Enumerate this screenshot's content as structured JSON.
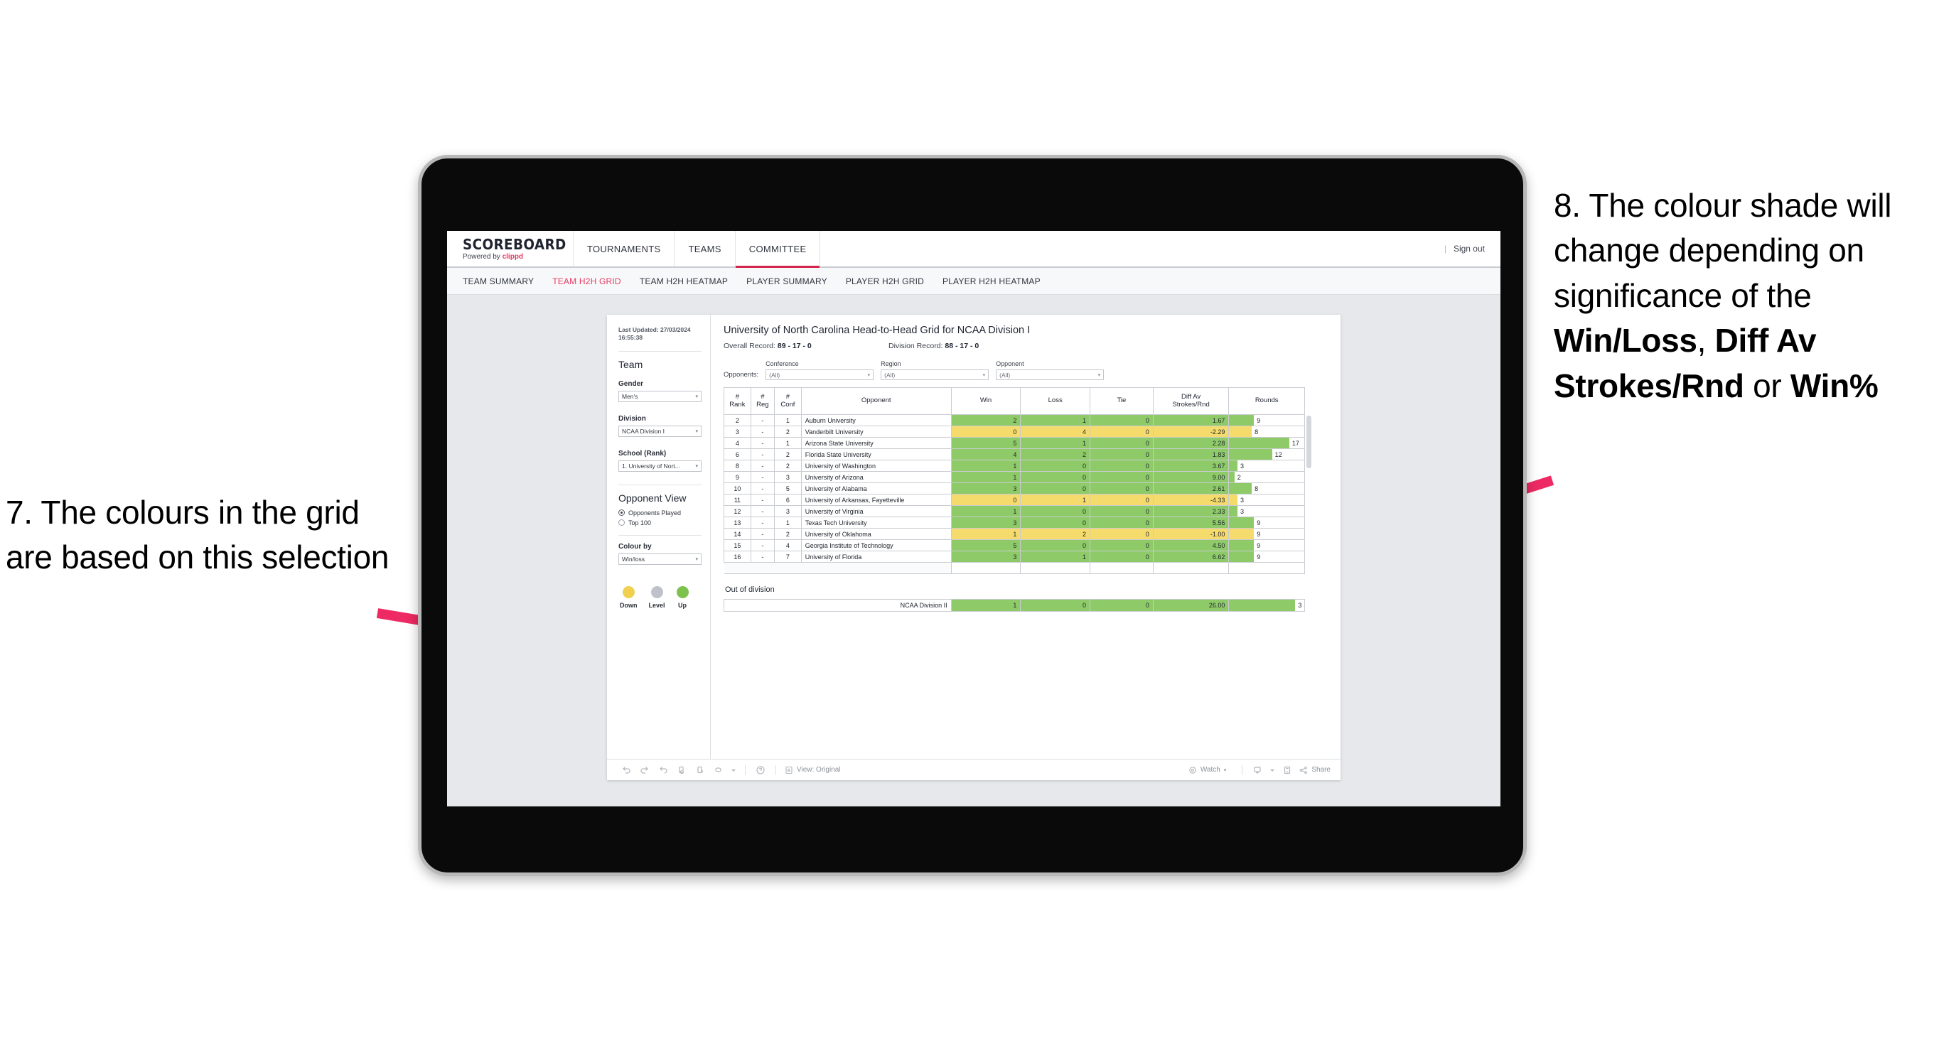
{
  "annotations": {
    "left": {
      "number": "7.",
      "text": "The colours in the grid are based on this selection"
    },
    "right": {
      "number": "8.",
      "line1": "The colour shade will change depending on significance of the ",
      "bold1": "Win/Loss",
      "mid1": ", ",
      "bold2": "Diff Av Strokes/Rnd",
      "mid2": " or ",
      "bold3": "Win%"
    }
  },
  "app": {
    "brand": {
      "title": "SCOREBOARD",
      "powered_prefix": "Powered by ",
      "powered_name": "clippd"
    },
    "topnav": [
      {
        "label": "TOURNAMENTS",
        "active": false
      },
      {
        "label": "TEAMS",
        "active": false
      },
      {
        "label": "COMMITTEE",
        "active": true
      }
    ],
    "signout": {
      "separator": "|",
      "label": "Sign out"
    },
    "subnav": [
      {
        "label": "TEAM SUMMARY",
        "active": false
      },
      {
        "label": "TEAM H2H GRID",
        "active": true
      },
      {
        "label": "TEAM H2H HEATMAP",
        "active": false
      },
      {
        "label": "PLAYER SUMMARY",
        "active": false
      },
      {
        "label": "PLAYER H2H GRID",
        "active": false
      },
      {
        "label": "PLAYER H2H HEATMAP",
        "active": false
      }
    ]
  },
  "filters": {
    "last_updated_label": "Last Updated: 27/03/2024",
    "last_updated_time": "16:55:38",
    "team_heading": "Team",
    "gender": {
      "label": "Gender",
      "value": "Men's"
    },
    "division": {
      "label": "Division",
      "value": "NCAA Division I"
    },
    "school": {
      "label": "School (Rank)",
      "value": "1. University of Nort..."
    },
    "opponent_view": {
      "heading": "Opponent View",
      "options": [
        {
          "label": "Opponents Played",
          "selected": true
        },
        {
          "label": "Top 100",
          "selected": false
        }
      ]
    },
    "colour_by": {
      "label": "Colour by",
      "value": "Win/loss"
    },
    "legend": [
      {
        "label": "Down",
        "color": "#f2d04f"
      },
      {
        "label": "Level",
        "color": "#bfc3c9"
      },
      {
        "label": "Up",
        "color": "#7dc24f"
      }
    ]
  },
  "view": {
    "title": "University of North Carolina Head-to-Head Grid for NCAA Division I",
    "overall_record_label": "Overall Record:",
    "overall_record_value": "89 - 17 - 0",
    "division_record_label": "Division Record:",
    "division_record_value": "88 - 17 - 0",
    "opponents_label": "Opponents:",
    "opponent_filters": [
      {
        "label": "Conference",
        "value": "(All)"
      },
      {
        "label": "Region",
        "value": "(All)"
      },
      {
        "label": "Opponent",
        "value": "(All)"
      }
    ],
    "columns": [
      "# Rank",
      "# Reg",
      "# Conf",
      "Opponent",
      "Win",
      "Loss",
      "Tie",
      "Diff Av Strokes/Rnd",
      "Rounds"
    ],
    "column_lines": [
      [
        "#",
        "Rank"
      ],
      [
        "#",
        "Reg"
      ],
      [
        "#",
        "Conf"
      ],
      [
        "Opponent",
        ""
      ],
      [
        "Win",
        ""
      ],
      [
        "Loss",
        ""
      ],
      [
        "Tie",
        ""
      ],
      [
        "Diff Av",
        "Strokes/Rnd"
      ],
      [
        "Rounds",
        ""
      ]
    ],
    "rows": [
      {
        "rank": "2",
        "reg": "-",
        "conf": "1",
        "opponent": "Auburn University",
        "win": "2",
        "loss": "1",
        "tie": "0",
        "diff": "1.67",
        "rounds": "9",
        "state": "up",
        "bar_pct": 33
      },
      {
        "rank": "3",
        "reg": "-",
        "conf": "2",
        "opponent": "Vanderbilt University",
        "win": "0",
        "loss": "4",
        "tie": "0",
        "diff": "-2.29",
        "rounds": "8",
        "state": "down",
        "bar_pct": 30
      },
      {
        "rank": "4",
        "reg": "-",
        "conf": "1",
        "opponent": "Arizona State University",
        "win": "5",
        "loss": "1",
        "tie": "0",
        "diff": "2.28",
        "rounds": "17",
        "state": "up",
        "bar_pct": 80
      },
      {
        "rank": "6",
        "reg": "-",
        "conf": "2",
        "opponent": "Florida State University",
        "win": "4",
        "loss": "2",
        "tie": "0",
        "diff": "1.83",
        "rounds": "12",
        "state": "up",
        "bar_pct": 57
      },
      {
        "rank": "8",
        "reg": "-",
        "conf": "2",
        "opponent": "University of Washington",
        "win": "1",
        "loss": "0",
        "tie": "0",
        "diff": "3.67",
        "rounds": "3",
        "state": "up",
        "bar_pct": 11
      },
      {
        "rank": "9",
        "reg": "-",
        "conf": "3",
        "opponent": "University of Arizona",
        "win": "1",
        "loss": "0",
        "tie": "0",
        "diff": "9.00",
        "rounds": "2",
        "state": "up",
        "bar_pct": 7
      },
      {
        "rank": "10",
        "reg": "-",
        "conf": "5",
        "opponent": "University of Alabama",
        "win": "3",
        "loss": "0",
        "tie": "0",
        "diff": "2.61",
        "rounds": "8",
        "state": "up",
        "bar_pct": 30
      },
      {
        "rank": "11",
        "reg": "-",
        "conf": "6",
        "opponent": "University of Arkansas, Fayetteville",
        "win": "0",
        "loss": "1",
        "tie": "0",
        "diff": "-4.33",
        "rounds": "3",
        "state": "down",
        "bar_pct": 11
      },
      {
        "rank": "12",
        "reg": "-",
        "conf": "3",
        "opponent": "University of Virginia",
        "win": "1",
        "loss": "0",
        "tie": "0",
        "diff": "2.33",
        "rounds": "3",
        "state": "up",
        "bar_pct": 11
      },
      {
        "rank": "13",
        "reg": "-",
        "conf": "1",
        "opponent": "Texas Tech University",
        "win": "3",
        "loss": "0",
        "tie": "0",
        "diff": "5.56",
        "rounds": "9",
        "state": "up",
        "bar_pct": 33
      },
      {
        "rank": "14",
        "reg": "-",
        "conf": "2",
        "opponent": "University of Oklahoma",
        "win": "1",
        "loss": "2",
        "tie": "0",
        "diff": "-1.00",
        "rounds": "9",
        "state": "down",
        "bar_pct": 33
      },
      {
        "rank": "15",
        "reg": "-",
        "conf": "4",
        "opponent": "Georgia Institute of Technology",
        "win": "5",
        "loss": "0",
        "tie": "0",
        "diff": "4.50",
        "rounds": "9",
        "state": "up",
        "bar_pct": 33
      },
      {
        "rank": "16",
        "reg": "-",
        "conf": "7",
        "opponent": "University of Florida",
        "win": "3",
        "loss": "1",
        "tie": "0",
        "diff": "6.62",
        "rounds": "9",
        "state": "up",
        "bar_pct": 33
      }
    ],
    "out_of_division": {
      "title": "Out of division",
      "row": {
        "opponent": "NCAA Division II",
        "win": "1",
        "loss": "0",
        "tie": "0",
        "diff": "26.00",
        "rounds": "3",
        "state": "up",
        "bar_pct": 88
      }
    }
  },
  "toolbar": {
    "view_label": "View: Original",
    "watch_label": "Watch",
    "share_label": "Share",
    "icons": [
      "undo-icon",
      "redo-icon",
      "revert-icon",
      "refresh-icon",
      "pause-icon",
      "reset-icon",
      "dropdown-caret-icon",
      "help-icon",
      "view-icon",
      "watch-icon",
      "device-icon",
      "fullscreen-icon",
      "share-icon"
    ]
  },
  "colors": {
    "accent_pink": "#e63a63",
    "arrow_pink": "#ed2a63",
    "up_green": "#8ecb68",
    "down_yellow": "#f5db6c",
    "level_grey": "#bfc3c9"
  }
}
